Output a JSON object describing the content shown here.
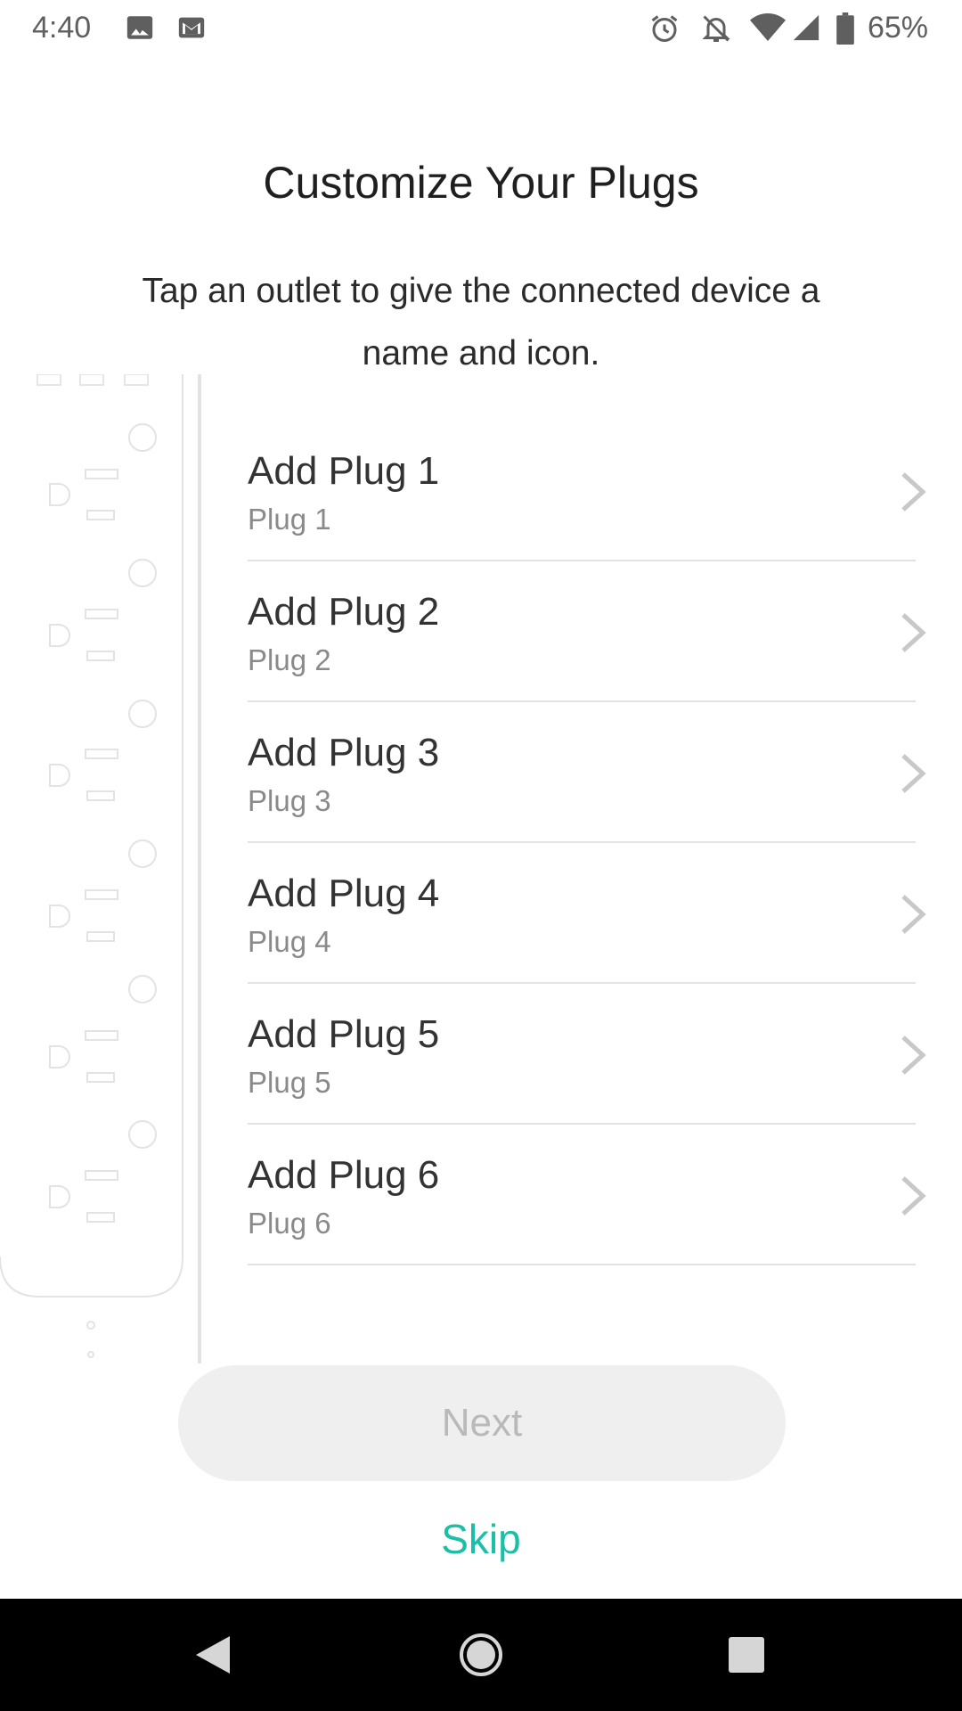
{
  "status_bar": {
    "time": "4:40",
    "battery": "65%",
    "icons": [
      "image-icon",
      "gmail-icon",
      "alarm-icon",
      "notifications-off-icon",
      "wifi-icon",
      "cell-signal-icon",
      "battery-icon"
    ]
  },
  "header": {
    "title": "Customize Your Plugs",
    "subtitle": "Tap an outlet to give the connected device a name and icon."
  },
  "plugs": [
    {
      "title": "Add Plug 1",
      "subtitle": "Plug 1"
    },
    {
      "title": "Add Plug 2",
      "subtitle": "Plug 2"
    },
    {
      "title": "Add Plug 3",
      "subtitle": "Plug 3"
    },
    {
      "title": "Add Plug 4",
      "subtitle": "Plug 4"
    },
    {
      "title": "Add Plug 5",
      "subtitle": "Plug 5"
    },
    {
      "title": "Add Plug 6",
      "subtitle": "Plug 6"
    }
  ],
  "actions": {
    "next_label": "Next",
    "skip_label": "Skip"
  },
  "colors": {
    "accent": "#1bbfa8",
    "disabled_button_bg": "#efefef",
    "disabled_button_text": "#b9b9b9"
  }
}
